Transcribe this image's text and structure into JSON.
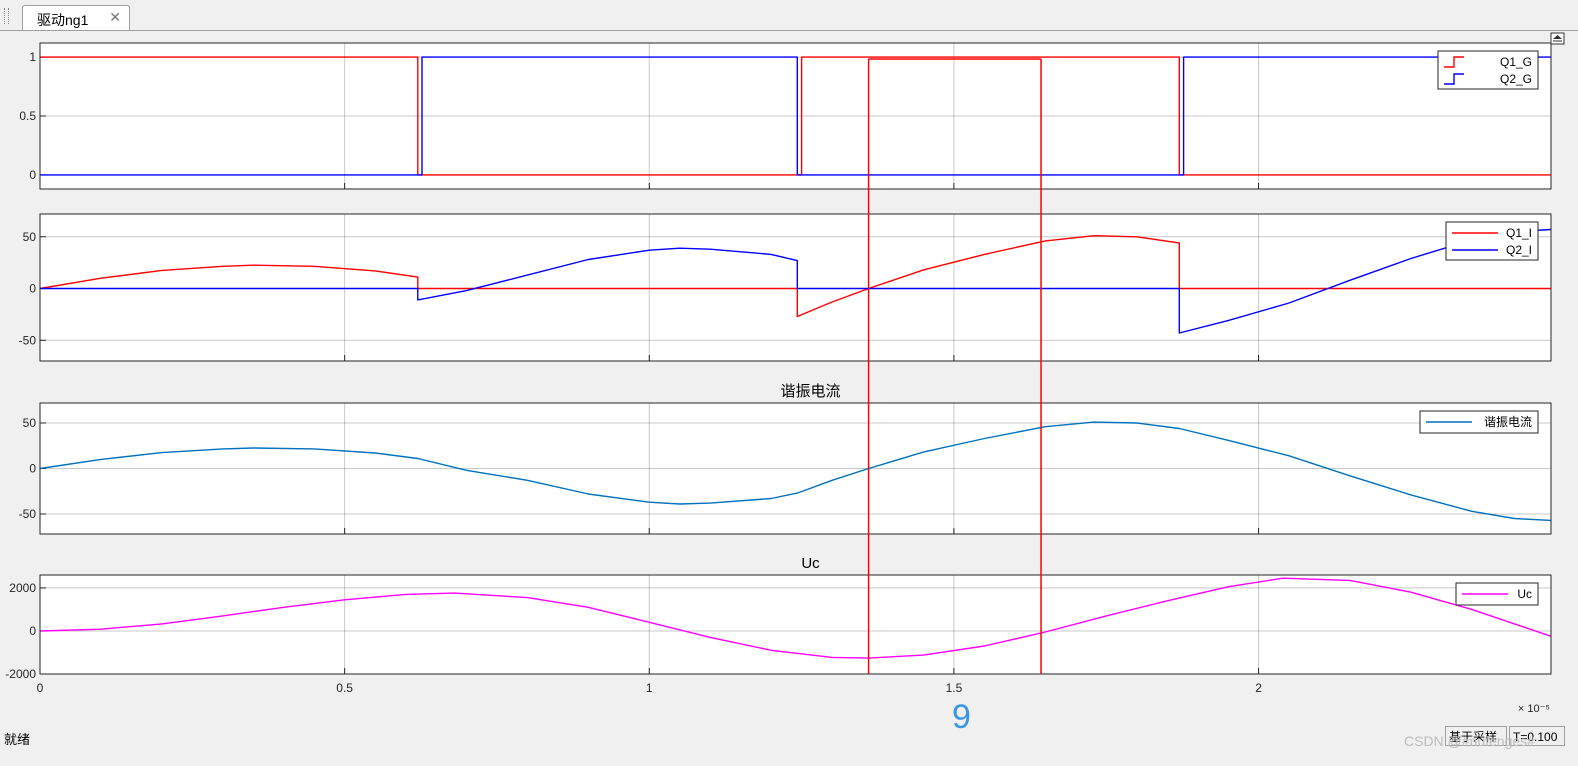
{
  "tab": {
    "label": "驱动ng1",
    "close_glyph": "✕"
  },
  "status": {
    "left_text": "就绪",
    "mode_label": "基于采样",
    "time_label": "T=0.100"
  },
  "overlay": {
    "page_number": "9",
    "watermark": "CSDN @#nufenges#"
  },
  "colors": {
    "red": "#ff0000",
    "blue": "#0000ff",
    "teal": "#0072bd",
    "magenta": "#ff00ff",
    "cursor": "#ff0000"
  },
  "chart_data": [
    {
      "type": "line",
      "title": "",
      "xlim": [
        0,
        2.48
      ],
      "ylim": [
        -0.12,
        1.12
      ],
      "yticks": [
        0,
        0.5,
        1
      ],
      "ytick_labels": [
        "0",
        "0.5",
        "1"
      ],
      "grid": true,
      "legend": "top-right",
      "legend_style": "step",
      "series": [
        {
          "name": "Q1_G",
          "color": "red",
          "x": [
            0,
            0.62,
            0.62,
            1.25,
            1.25,
            1.87,
            1.87,
            2.48
          ],
          "y": [
            1,
            1,
            0,
            0,
            1,
            1,
            0,
            0
          ]
        },
        {
          "name": "Q2_G",
          "color": "blue",
          "x": [
            0,
            0.627,
            0.627,
            1.243,
            1.243,
            1.877,
            1.877,
            2.48
          ],
          "y": [
            0,
            0,
            1,
            1,
            0,
            0,
            1,
            1
          ]
        }
      ]
    },
    {
      "type": "line",
      "title": "",
      "xlim": [
        0,
        2.48
      ],
      "ylim": [
        -70,
        72
      ],
      "yticks": [
        50,
        0,
        -50
      ],
      "ytick_labels": [
        "50",
        "0",
        "-50"
      ],
      "grid": true,
      "legend": "top-right",
      "legend_style": "line",
      "series": [
        {
          "name": "Q1_I",
          "color": "red",
          "x": [
            0,
            0.1,
            0.2,
            0.3,
            0.35,
            0.45,
            0.55,
            0.62,
            0.62,
            1.243,
            1.243,
            1.3,
            1.36,
            1.45,
            1.55,
            1.65,
            1.73,
            1.8,
            1.87,
            1.87,
            2.48
          ],
          "y": [
            0,
            10,
            17.5,
            21.5,
            22.5,
            21.5,
            17,
            11,
            0,
            0,
            -27,
            -13,
            0,
            18,
            33,
            46,
            51,
            50,
            44,
            0,
            0
          ]
        },
        {
          "name": "Q2_I",
          "color": "blue",
          "x": [
            0,
            0.62,
            0.62,
            0.7,
            0.8,
            0.9,
            1.0,
            1.05,
            1.1,
            1.2,
            1.243,
            1.243,
            1.87,
            1.87,
            1.95,
            2.05,
            2.15,
            2.25,
            2.35,
            2.42,
            2.48
          ],
          "y": [
            0,
            0,
            -11,
            -2,
            13,
            28,
            37,
            39,
            38,
            33,
            27,
            0,
            0,
            -43,
            -31,
            -14,
            8,
            29,
            47,
            55,
            57
          ]
        }
      ]
    },
    {
      "type": "line",
      "title": "谐振电流",
      "xlim": [
        0,
        2.48
      ],
      "ylim": [
        -72,
        72
      ],
      "yticks": [
        50,
        0,
        -50
      ],
      "ytick_labels": [
        "50",
        "0",
        "-50"
      ],
      "grid": true,
      "legend": "top-right",
      "legend_style": "line",
      "series": [
        {
          "name": "谐振电流",
          "color": "teal",
          "x": [
            0,
            0.1,
            0.2,
            0.3,
            0.35,
            0.45,
            0.55,
            0.62,
            0.7,
            0.8,
            0.9,
            1.0,
            1.05,
            1.1,
            1.2,
            1.243,
            1.3,
            1.36,
            1.45,
            1.55,
            1.65,
            1.73,
            1.8,
            1.87,
            1.95,
            2.05,
            2.15,
            2.25,
            2.35,
            2.42,
            2.48
          ],
          "y": [
            0,
            10,
            17.5,
            21.5,
            22.5,
            21.5,
            17,
            11,
            -2,
            -13,
            -28,
            -37,
            -39,
            -38,
            -33,
            -27,
            -13,
            0,
            18,
            33,
            46,
            51,
            50,
            44,
            31,
            14,
            -8,
            -29,
            -47,
            -55,
            -57
          ]
        }
      ]
    },
    {
      "type": "line",
      "title": "Uc",
      "xlim": [
        0,
        2.48
      ],
      "ylim": [
        -2000,
        2600
      ],
      "yticks": [
        2000,
        0,
        -2000
      ],
      "ytick_labels": [
        "2000",
        "0",
        "-2000"
      ],
      "xticks": [
        0,
        0.5,
        1,
        1.5,
        2
      ],
      "xtick_labels": [
        "0",
        "0.5",
        "1",
        "1.5",
        "2"
      ],
      "x_exponent_label": "× 10⁻⁵",
      "grid": true,
      "legend": "top-right",
      "legend_style": "line",
      "series": [
        {
          "name": "Uc",
          "color": "magenta",
          "x": [
            0,
            0.1,
            0.2,
            0.3,
            0.4,
            0.5,
            0.6,
            0.68,
            0.8,
            0.9,
            1.0,
            1.1,
            1.2,
            1.3,
            1.36,
            1.45,
            1.55,
            1.65,
            1.75,
            1.85,
            1.95,
            2.04,
            2.15,
            2.25,
            2.35,
            2.48
          ],
          "y": [
            0,
            80,
            330,
            700,
            1100,
            1450,
            1700,
            1760,
            1550,
            1100,
            400,
            -300,
            -900,
            -1230,
            -1260,
            -1120,
            -700,
            -50,
            700,
            1400,
            2050,
            2450,
            2350,
            1800,
            1000,
            -250
          ]
        }
      ]
    }
  ],
  "cursors": {
    "x": [
      1.36,
      1.643
    ]
  }
}
